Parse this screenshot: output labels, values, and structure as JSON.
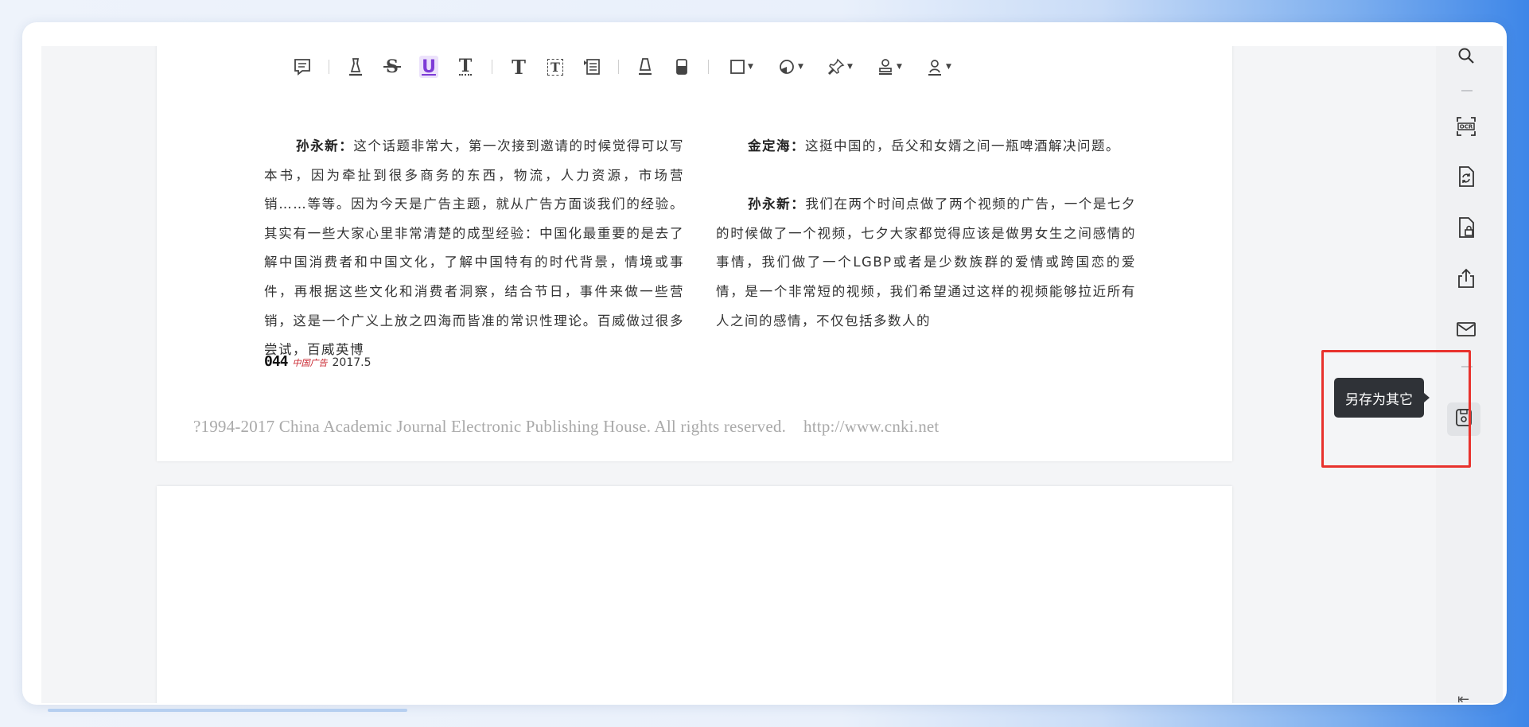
{
  "toolbar": {
    "items": [
      {
        "name": "comment-icon"
      },
      {
        "name": "highlight-pen-icon"
      },
      {
        "name": "strikethrough-icon",
        "glyph": "S"
      },
      {
        "name": "underline-icon",
        "glyph": "U"
      },
      {
        "name": "squiggly-underline-icon",
        "glyph": "T"
      },
      {
        "name": "text-icon",
        "glyph": "T"
      },
      {
        "name": "textbox-icon",
        "glyph": "T"
      },
      {
        "name": "callout-icon"
      },
      {
        "name": "pencil-icon"
      },
      {
        "name": "eraser-icon"
      },
      {
        "name": "shape-icon"
      },
      {
        "name": "color-fill-icon"
      },
      {
        "name": "pin-icon"
      },
      {
        "name": "stamp-icon"
      },
      {
        "name": "signature-icon"
      }
    ]
  },
  "document": {
    "left_column": {
      "speaker": "孙永新：",
      "text": "这个话题非常大，第一次接到邀请的时候觉得可以写本书，因为牵扯到很多商务的东西，物流，人力资源，市场营销……等等。因为今天是广告主题，就从广告方面谈我们的经验。其实有一些大家心里非常清楚的成型经验：中国化最重要的是去了解中国消费者和中国文化，了解中国特有的时代背景，情境或事件，再根据这些文化和消费者洞察，结合节日，事件来做一些营销，这是一个广义上放之四海而皆准的常识性理论。百威做过很多尝试，百威英博"
    },
    "right_column": {
      "para1_speaker": "金定海：",
      "para1_text": "这挺中国的，岳父和女婿之间一瓶啤酒解决问题。",
      "para2_speaker": "孙永新：",
      "para2_text": "我们在两个时间点做了两个视频的广告，一个是七夕的时候做了一个视频，七夕大家都觉得应该是做男女生之间感情的事情，我们做了一个LGBP或者是少数族群的爱情或跨国恋的爱情，是一个非常短的视频，我们希望通过这样的视频能够拉近所有人之间的感情，不仅包括多数人的"
    },
    "page_number": "044",
    "magazine_logo": "中国广告",
    "issue_date": "2017.5",
    "copyright": "?1994-2017 China Academic Journal Electronic Publishing House. All rights reserved.",
    "copyright_url": "http://www.cnki.net"
  },
  "sidebar": {
    "items": [
      {
        "name": "search-icon"
      },
      {
        "name": "ocr-icon",
        "label": "OCR"
      },
      {
        "name": "convert-file-icon"
      },
      {
        "name": "lock-file-icon"
      },
      {
        "name": "share-icon"
      },
      {
        "name": "mail-icon"
      },
      {
        "name": "save-as-other-icon"
      }
    ],
    "tooltip": "另存为其它"
  },
  "colors": {
    "highlight_box": "#e8322d",
    "active_tool": "#7d3bd6",
    "tooltip_bg": "#2f3237"
  }
}
